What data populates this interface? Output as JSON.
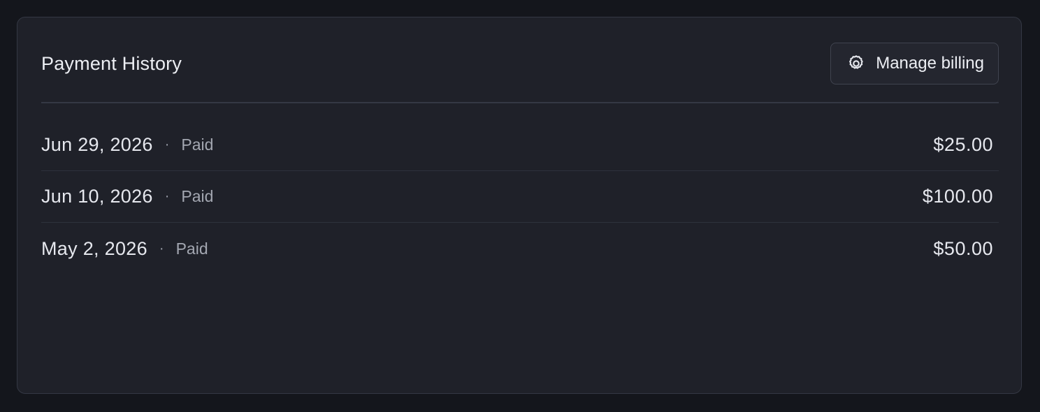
{
  "card": {
    "title": "Payment History",
    "manage_button": {
      "label": "Manage billing",
      "icon": "gear-icon"
    }
  },
  "separator": "·",
  "payments": [
    {
      "date": "Jun 29, 2026",
      "status": "Paid",
      "amount": "$25.00"
    },
    {
      "date": "Jun 10, 2026",
      "status": "Paid",
      "amount": "$100.00"
    },
    {
      "date": "May 2, 2026",
      "status": "Paid",
      "amount": "$50.00"
    }
  ],
  "colors": {
    "page_background": "#14161c",
    "card_background": "#1f2129",
    "border": "#343844",
    "text_primary": "#e6e8ee",
    "text_secondary": "#a3a7b1"
  }
}
